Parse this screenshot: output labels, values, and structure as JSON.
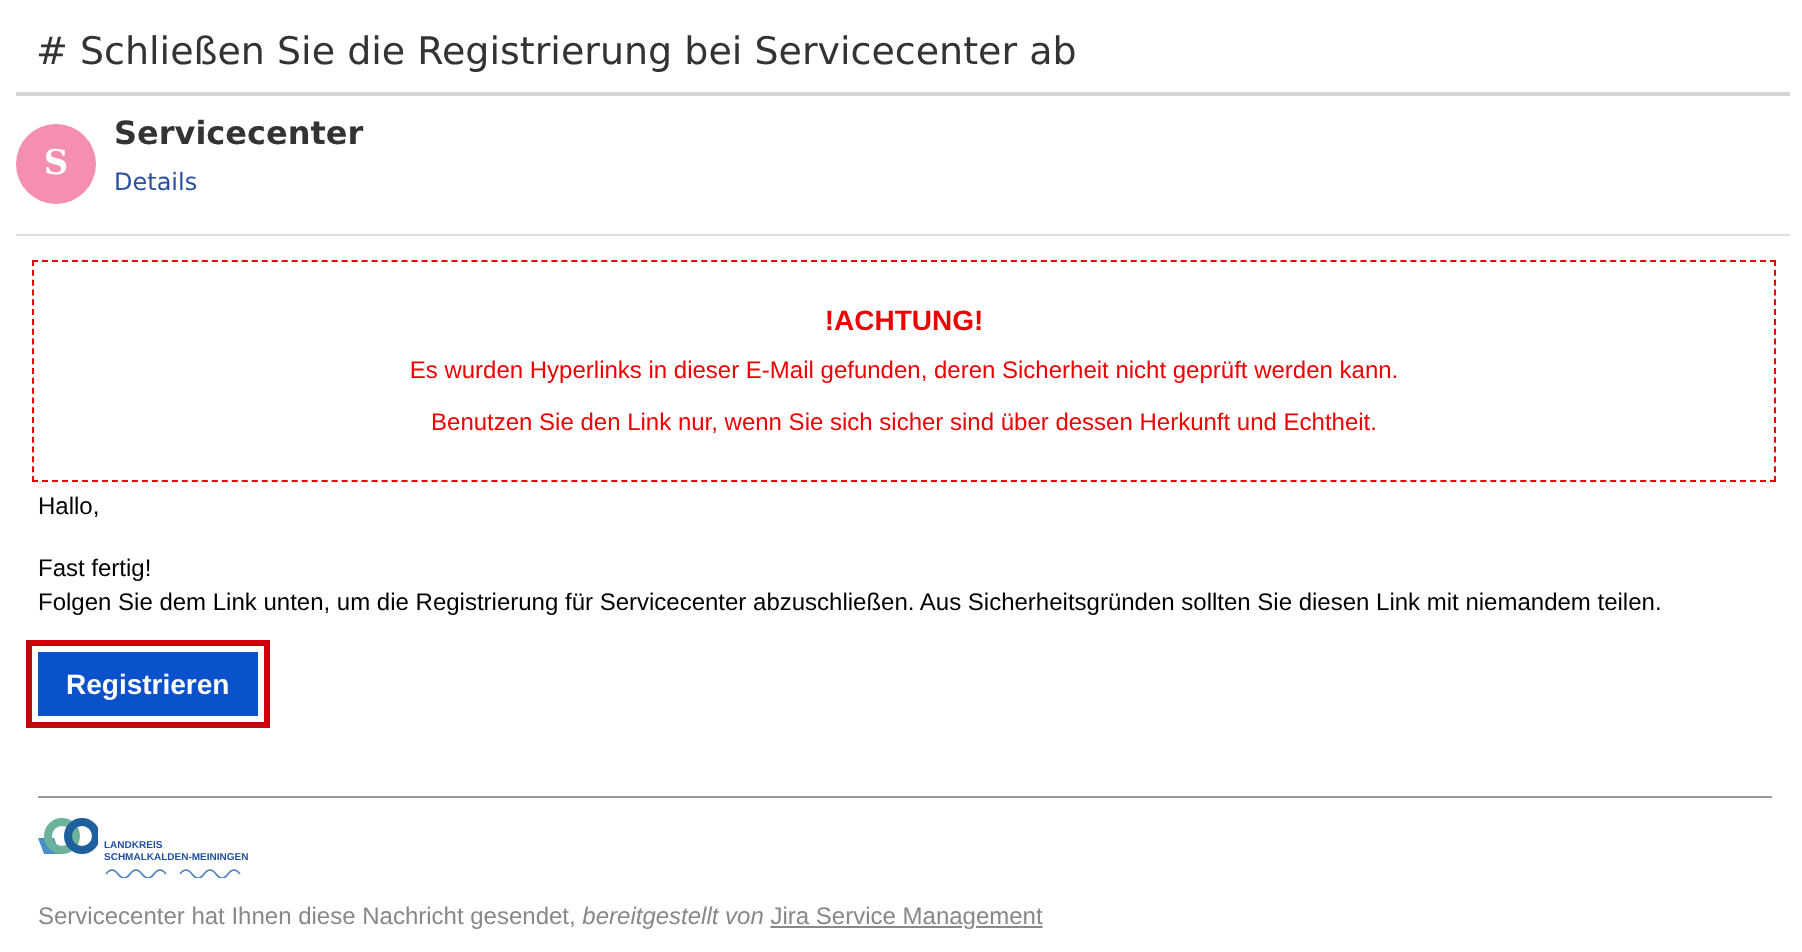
{
  "title": "# Schließen Sie die Registrierung bei Servicecenter ab",
  "sender": {
    "avatar_letter": "S",
    "name": "Servicecenter",
    "details_link": "Details"
  },
  "warning": {
    "heading": "!ACHTUNG!",
    "lines": [
      "Es wurden Hyperlinks in dieser E-Mail gefunden, deren Sicherheit nicht geprüft werden kann.",
      "Benutzen Sie den Link nur, wenn Sie sich sicher sind über dessen Herkunft und Echtheit."
    ]
  },
  "body": {
    "greeting": "Hallo,",
    "lines": [
      "Fast fertig!",
      "Folgen Sie dem Link unten, um die Registrierung für Servicecenter abzuschließen. Aus Sicherheitsgründen sollten Sie diesen Link mit niemandem teilen."
    ]
  },
  "button": {
    "label": "Registrieren",
    "highlighted": true
  },
  "logo": {
    "lines": [
      "LANDKREIS",
      "SCHMALKALDEN-MEININGEN"
    ]
  },
  "footer": {
    "text": "Servicecenter hat Ihnen diese Nachricht gesendet, *bereitgestellt von*",
    "link": "Jira Service Management"
  }
}
